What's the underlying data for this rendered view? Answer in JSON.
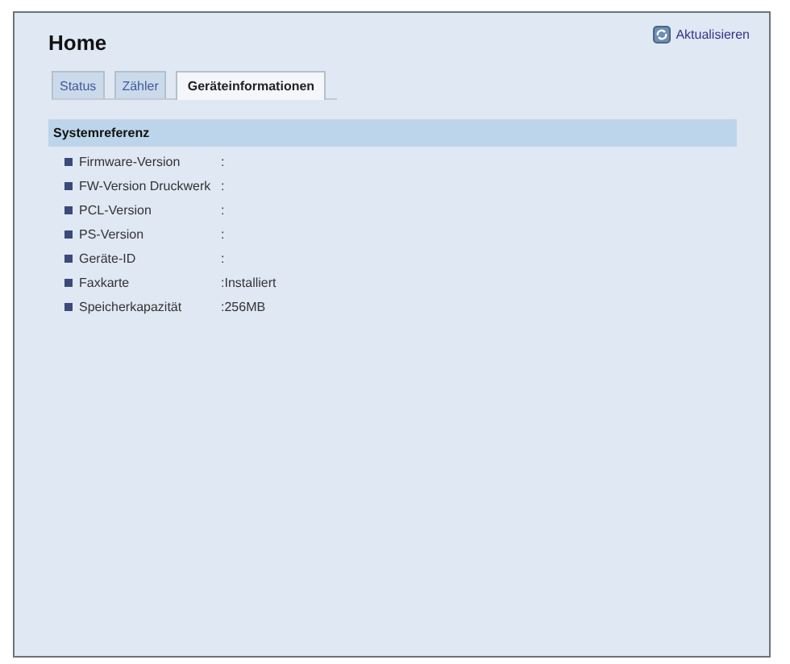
{
  "page": {
    "title": "Home",
    "refresh": "Aktualisieren"
  },
  "tabs": [
    {
      "label": "Status",
      "selected": false
    },
    {
      "label": "Zähler",
      "selected": false
    },
    {
      "label": "Geräteinformationen",
      "selected": true
    }
  ],
  "section": {
    "title": "Systemreferenz",
    "rows": [
      {
        "label": "Firmware-Version",
        "separator": ":"
      },
      {
        "label": "FW-Version Druckwerk",
        "separator": ":"
      },
      {
        "label": "PCL-Version",
        "separator": ":"
      },
      {
        "label": "PS-Version",
        "separator": ":"
      },
      {
        "label": "Geräte-ID",
        "separator": ":"
      },
      {
        "label": "Faxkarte",
        "separator": ":",
        "value": "Installiert"
      },
      {
        "label": "Speicherkapazität",
        "separator": ":",
        "value": "256MB"
      }
    ]
  }
}
